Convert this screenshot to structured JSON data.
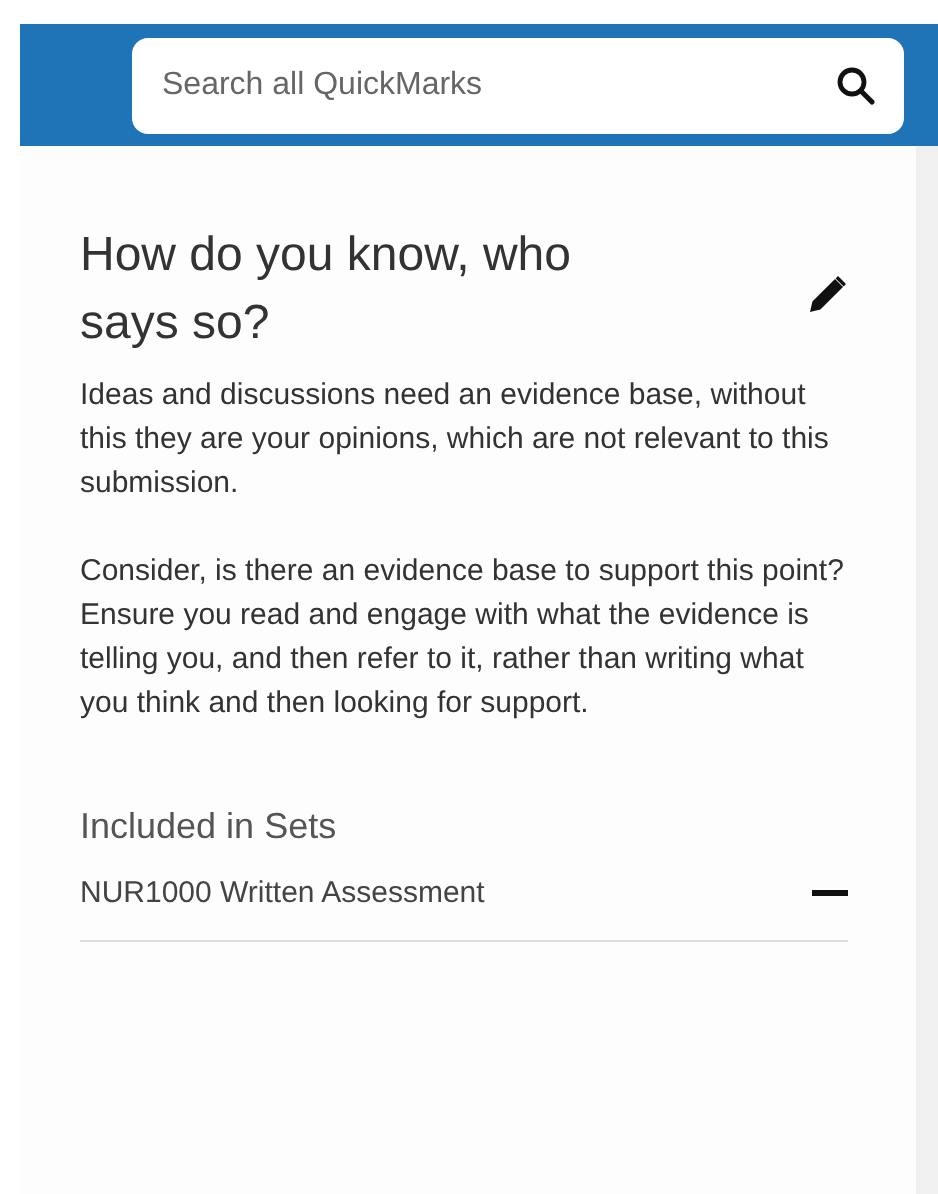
{
  "search": {
    "placeholder": "Search all QuickMarks"
  },
  "quickmark": {
    "title": "How do you know, who says so?",
    "paragraphs": [
      "Ideas and discussions need an evidence base, without this they are your opinions, which are not relevant to this submission.",
      "Consider, is there an evidence base to support this point? Ensure you read and engage with what the evidence is telling you, and then refer to it, rather than writing what you think and then looking for support."
    ]
  },
  "sets": {
    "heading": "Included in Sets",
    "items": [
      {
        "name": "NUR1000 Written Assessment"
      }
    ]
  }
}
